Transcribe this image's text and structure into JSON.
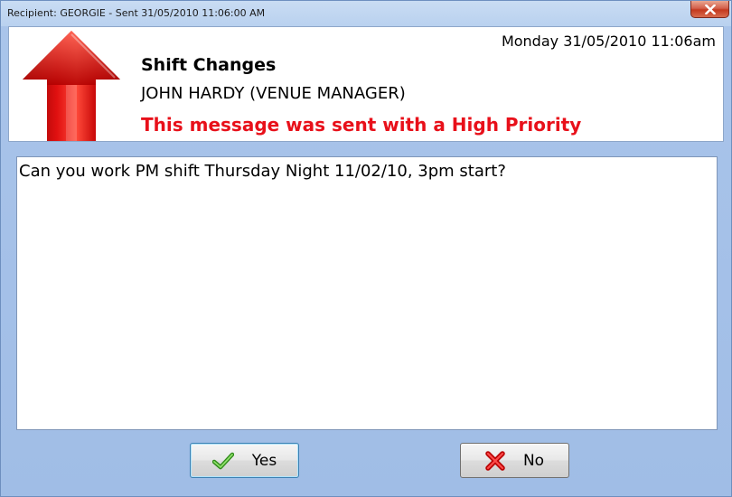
{
  "window": {
    "title": "Recipient: GEORGIE  - Sent 31/05/2010 11:06:00 AM",
    "close_icon": "close-icon"
  },
  "header": {
    "datetime": "Monday 31/05/2010 11:06am",
    "subject": "Shift Changes",
    "sender": "JOHN HARDY (VENUE MANAGER)",
    "priority_notice": "This message was sent with a High Priority",
    "priority_icon": "high-priority-arrow-icon",
    "priority_color": "#e8101a"
  },
  "message": {
    "body": "Can you work PM shift Thursday Night 11/02/10, 3pm start?"
  },
  "buttons": {
    "yes_label": "Yes",
    "yes_icon": "checkmark-icon",
    "no_label": "No",
    "no_icon": "cross-icon"
  }
}
